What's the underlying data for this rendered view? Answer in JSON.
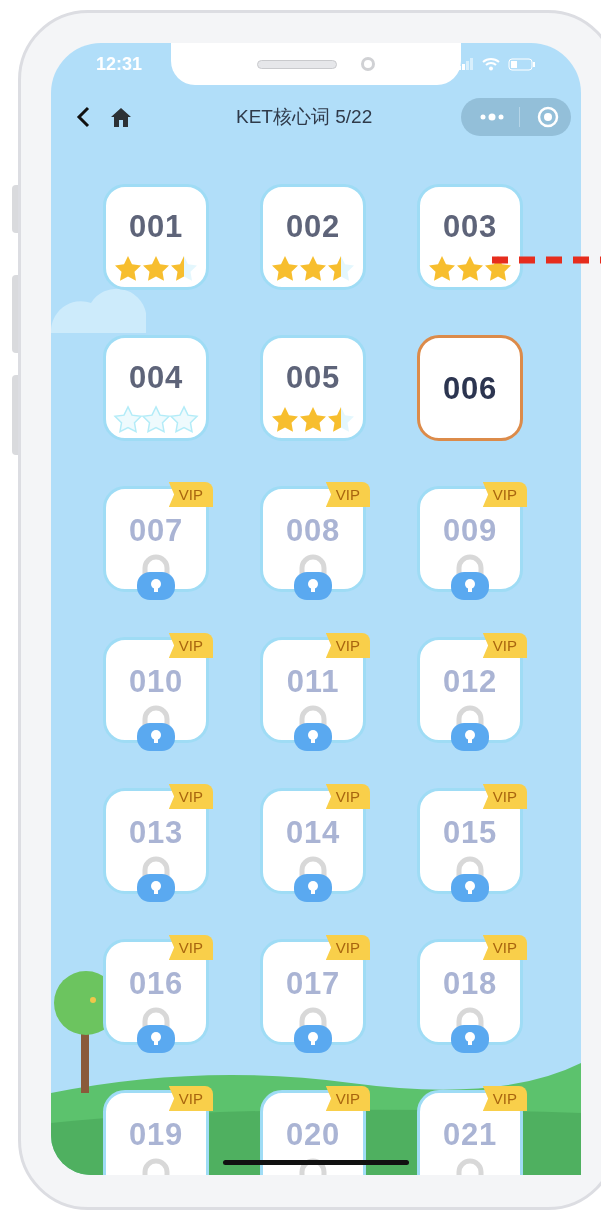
{
  "status_bar": {
    "time": "12:31"
  },
  "nav": {
    "title": "KET核心词 5/22"
  },
  "levels": [
    {
      "label": "001",
      "kind": "unlocked",
      "stars": 2.5,
      "selected": false
    },
    {
      "label": "002",
      "kind": "unlocked",
      "stars": 2.5,
      "selected": false
    },
    {
      "label": "003",
      "kind": "unlocked",
      "stars": 3,
      "selected": false
    },
    {
      "label": "004",
      "kind": "unlocked",
      "stars": 0,
      "selected": false
    },
    {
      "label": "005",
      "kind": "unlocked",
      "stars": 2.5,
      "selected": false
    },
    {
      "label": "006",
      "kind": "current",
      "selected": true
    },
    {
      "label": "007",
      "kind": "locked",
      "badge": "VIP",
      "selected": false
    },
    {
      "label": "008",
      "kind": "locked",
      "badge": "VIP",
      "selected": false
    },
    {
      "label": "009",
      "kind": "locked",
      "badge": "VIP",
      "selected": false
    },
    {
      "label": "010",
      "kind": "locked",
      "badge": "VIP",
      "selected": false
    },
    {
      "label": "011",
      "kind": "locked",
      "badge": "VIP",
      "selected": false
    },
    {
      "label": "012",
      "kind": "locked",
      "badge": "VIP",
      "selected": false
    },
    {
      "label": "013",
      "kind": "locked",
      "badge": "VIP",
      "selected": false
    },
    {
      "label": "014",
      "kind": "locked",
      "badge": "VIP",
      "selected": false
    },
    {
      "label": "015",
      "kind": "locked",
      "badge": "VIP",
      "selected": false
    },
    {
      "label": "016",
      "kind": "locked",
      "badge": "VIP",
      "selected": false
    },
    {
      "label": "017",
      "kind": "locked",
      "badge": "VIP",
      "selected": false
    },
    {
      "label": "018",
      "kind": "locked",
      "badge": "VIP",
      "selected": false
    },
    {
      "label": "019",
      "kind": "locked",
      "badge": "VIP",
      "selected": false
    },
    {
      "label": "020",
      "kind": "locked",
      "badge": "VIP",
      "selected": false
    },
    {
      "label": "021",
      "kind": "locked",
      "badge": "VIP",
      "selected": false
    }
  ]
}
